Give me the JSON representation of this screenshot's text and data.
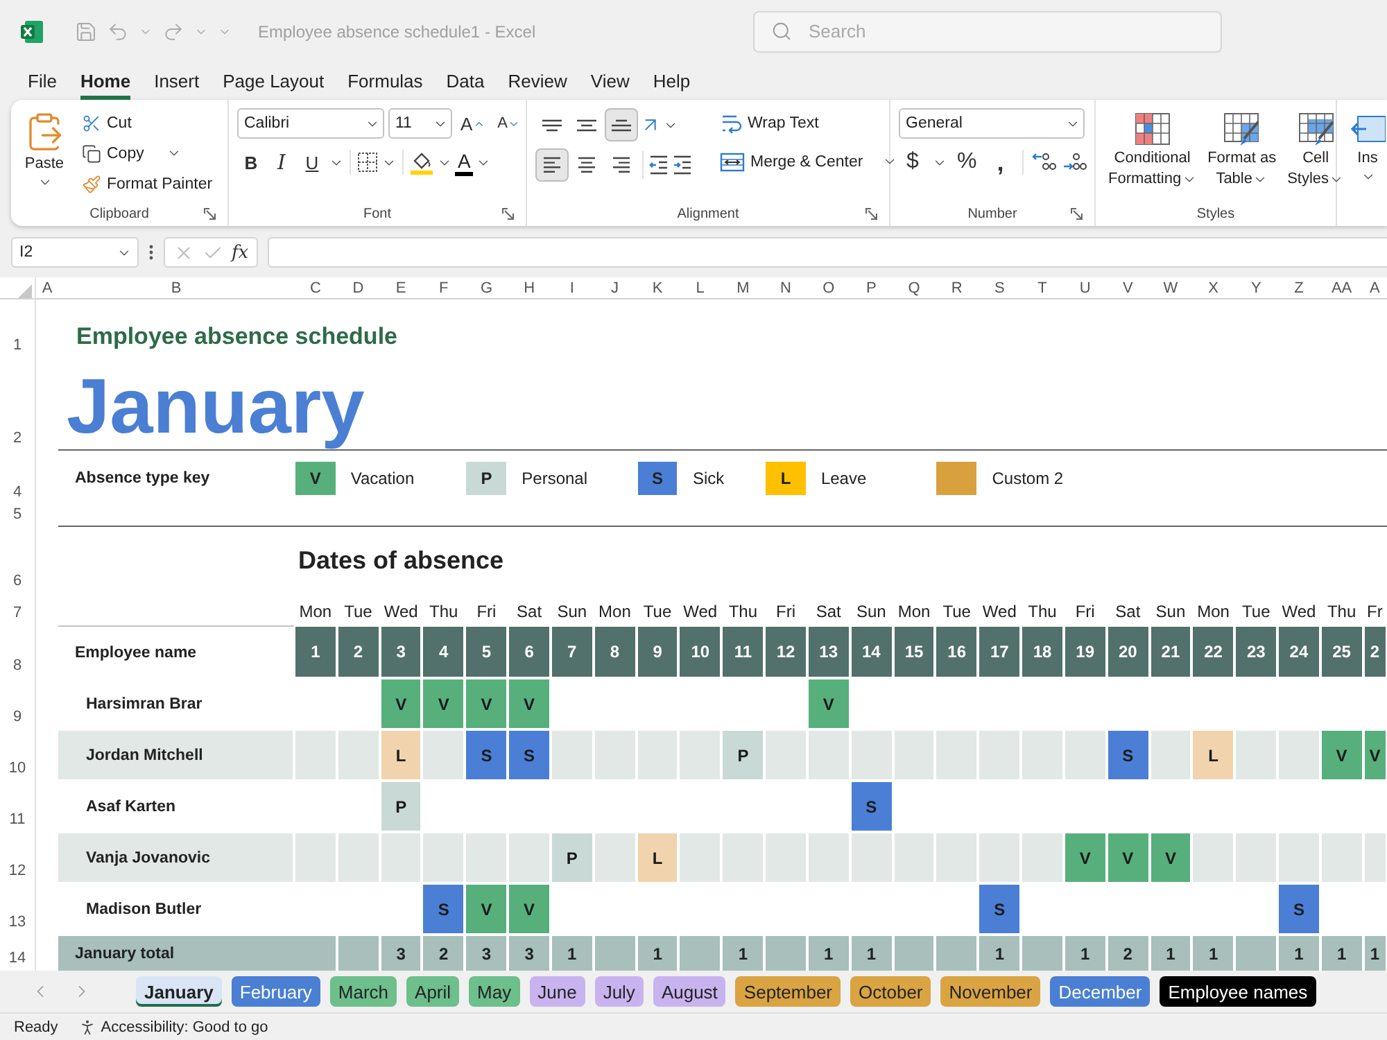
{
  "titlebar": {
    "title": "Employee absence schedule1 - Excel",
    "search": {
      "placeholder": "Search"
    }
  },
  "menu": [
    {
      "label": "File",
      "selected": false
    },
    {
      "label": "Home",
      "selected": true
    },
    {
      "label": "Insert",
      "selected": false
    },
    {
      "label": "Page Layout",
      "selected": false
    },
    {
      "label": "Formulas",
      "selected": false
    },
    {
      "label": "Data",
      "selected": false
    },
    {
      "label": "Review",
      "selected": false
    },
    {
      "label": "View",
      "selected": false
    },
    {
      "label": "Help",
      "selected": false
    }
  ],
  "ribbon": {
    "clipboard": {
      "label": "Clipboard",
      "paste": "Paste",
      "cut": "Cut",
      "copy": "Copy",
      "format_painter": "Format Painter"
    },
    "font": {
      "label": "Font",
      "font_name": "Calibri",
      "font_size": "11",
      "grow": "A",
      "shrink": "A",
      "bold": "B",
      "italic": "I",
      "underline": "U",
      "font_color": "A"
    },
    "alignment": {
      "label": "Alignment",
      "vertical": [
        {
          "kind": "top",
          "selected": false
        },
        {
          "kind": "middle",
          "selected": false
        },
        {
          "kind": "bottom",
          "selected": true
        }
      ],
      "horizontal": [
        {
          "kind": "left",
          "selected": true
        },
        {
          "kind": "center",
          "selected": false
        },
        {
          "kind": "right",
          "selected": false
        }
      ],
      "wrap_text": "Wrap Text",
      "merge": "Merge & Center"
    },
    "number": {
      "label": "Number",
      "format": "General",
      "currency": "$",
      "percent": "%",
      "comma": ","
    },
    "styles": {
      "label": "Styles",
      "buttons": [
        {
          "kind": "conditional",
          "lines": [
            "Conditional",
            "Formatting"
          ]
        },
        {
          "kind": "table",
          "lines": [
            "Format as",
            "Table"
          ]
        },
        {
          "kind": "cell",
          "lines": [
            "Cell",
            "Styles"
          ]
        }
      ]
    },
    "insert": {
      "label": "Ins"
    }
  },
  "formula_bar": {
    "name_box": "I2",
    "function_label": "fx"
  },
  "columns": [
    "A",
    "B",
    "C",
    "D",
    "E",
    "F",
    "G",
    "H",
    "I",
    "J",
    "K",
    "L",
    "M",
    "N",
    "O",
    "P",
    "Q",
    "R",
    "S",
    "T",
    "U",
    "V",
    "W",
    "X",
    "Y",
    "Z",
    "AA",
    "A"
  ],
  "row_headers": [
    "1",
    "2",
    "4",
    "5",
    "6",
    "7",
    "8",
    "9",
    "10",
    "11",
    "12",
    "13",
    "14"
  ],
  "sheet": {
    "title": "Employee absence schedule",
    "month": "January",
    "key_label": "Absence type key",
    "key": [
      {
        "kind": "vacation",
        "code": "V",
        "label": "Vacation"
      },
      {
        "kind": "personal",
        "code": "P",
        "label": "Personal"
      },
      {
        "kind": "sick",
        "code": "S",
        "label": "Sick"
      },
      {
        "kind": "leave",
        "code": "L",
        "label": "Leave"
      },
      {
        "kind": "custom",
        "label": "Custom 2"
      }
    ],
    "dates_heading": "Dates of absence",
    "weekdays": [
      "Mon",
      "Tue",
      "Wed",
      "Thu",
      "Fri",
      "Sat",
      "Sun",
      "Mon",
      "Tue",
      "Wed",
      "Thu",
      "Fri",
      "Sat",
      "Sun",
      "Mon",
      "Tue",
      "Wed",
      "Thu",
      "Fri",
      "Sat",
      "Sun",
      "Mon",
      "Tue",
      "Wed",
      "Thu",
      "Fr"
    ],
    "name_header": "Employee name",
    "days": [
      "1",
      "2",
      "3",
      "4",
      "5",
      "6",
      "7",
      "8",
      "9",
      "10",
      "11",
      "12",
      "13",
      "14",
      "15",
      "16",
      "17",
      "18",
      "19",
      "20",
      "21",
      "22",
      "23",
      "24",
      "25",
      "2"
    ],
    "employees": [
      {
        "name": "Harsimran Brar",
        "cells": [
          {},
          {},
          {
            "kind": "vacation",
            "code": "V"
          },
          {
            "kind": "vacation",
            "code": "V"
          },
          {
            "kind": "vacation",
            "code": "V"
          },
          {
            "kind": "vacation",
            "code": "V"
          },
          {},
          {},
          {},
          {},
          {},
          {},
          {
            "kind": "vacation",
            "code": "V"
          },
          {},
          {},
          {},
          {},
          {},
          {},
          {},
          {},
          {},
          {},
          {},
          {},
          {}
        ]
      },
      {
        "name": "Jordan Mitchell",
        "cells": [
          {},
          {},
          {
            "kind": "leave",
            "code": "L"
          },
          {},
          {
            "kind": "sick",
            "code": "S"
          },
          {
            "kind": "sick",
            "code": "S"
          },
          {},
          {},
          {},
          {},
          {
            "kind": "personal",
            "code": "P"
          },
          {},
          {},
          {},
          {},
          {},
          {},
          {},
          {},
          {
            "kind": "sick",
            "code": "S"
          },
          {},
          {
            "kind": "leave",
            "code": "L"
          },
          {},
          {},
          {
            "kind": "vacation",
            "code": "V"
          },
          {
            "kind": "vacation",
            "code": "V"
          }
        ]
      },
      {
        "name": "Asaf Karten",
        "cells": [
          {},
          {},
          {
            "kind": "personal",
            "code": "P"
          },
          {},
          {},
          {},
          {},
          {},
          {},
          {},
          {},
          {},
          {},
          {
            "kind": "sick",
            "code": "S"
          },
          {},
          {},
          {},
          {},
          {},
          {},
          {},
          {},
          {},
          {},
          {},
          {}
        ]
      },
      {
        "name": "Vanja Jovanovic",
        "cells": [
          {},
          {},
          {},
          {},
          {},
          {},
          {
            "kind": "personal",
            "code": "P"
          },
          {},
          {
            "kind": "leave",
            "code": "L"
          },
          {},
          {},
          {},
          {},
          {},
          {},
          {},
          {},
          {},
          {
            "kind": "vacation",
            "code": "V"
          },
          {
            "kind": "vacation",
            "code": "V"
          },
          {
            "kind": "vacation",
            "code": "V"
          },
          {},
          {},
          {},
          {},
          {}
        ]
      },
      {
        "name": "Madison Butler",
        "cells": [
          {},
          {},
          {},
          {
            "kind": "sick",
            "code": "S"
          },
          {
            "kind": "vacation",
            "code": "V"
          },
          {
            "kind": "vacation",
            "code": "V"
          },
          {},
          {},
          {},
          {},
          {},
          {},
          {},
          {},
          {},
          {},
          {
            "kind": "sick",
            "code": "S"
          },
          {},
          {},
          {},
          {},
          {},
          {},
          {
            "kind": "sick",
            "code": "S"
          },
          {},
          {}
        ]
      }
    ],
    "total": {
      "label": "January total",
      "cells": [
        {},
        {
          "value": "3"
        },
        {
          "value": "2"
        },
        {
          "value": "3"
        },
        {
          "value": "3"
        },
        {
          "value": "1"
        },
        {},
        {
          "value": "1"
        },
        {},
        {
          "value": "1"
        },
        {},
        {
          "value": "1"
        },
        {
          "value": "1"
        },
        {},
        {},
        {
          "value": "1"
        },
        {},
        {
          "value": "1"
        },
        {
          "value": "2"
        },
        {
          "value": "1"
        },
        {
          "value": "1"
        },
        {},
        {
          "value": "1"
        },
        {
          "value": "1"
        },
        {
          "value": "1"
        }
      ]
    }
  },
  "sheet_tabs": [
    {
      "label": "January",
      "selected": true
    },
    {
      "label": "February",
      "selected": false,
      "color": "#4a7fd4"
    },
    {
      "label": "March",
      "selected": false,
      "color": "#6dbf8c"
    },
    {
      "label": "April",
      "selected": false,
      "color": "#6dbf8c"
    },
    {
      "label": "May",
      "selected": false,
      "color": "#6dbf8c"
    },
    {
      "label": "June",
      "selected": false,
      "color": "#c9b3ef"
    },
    {
      "label": "July",
      "selected": false,
      "color": "#c9b3ef"
    },
    {
      "label": "August",
      "selected": false,
      "color": "#c9b3ef"
    },
    {
      "label": "September",
      "selected": false,
      "color": "#d9a441"
    },
    {
      "label": "October",
      "selected": false,
      "color": "#d9a441"
    },
    {
      "label": "November",
      "selected": false,
      "color": "#d9a441"
    },
    {
      "label": "December",
      "selected": false,
      "color": "#4a7fd4"
    },
    {
      "label": "Employee names",
      "selected": false,
      "color": "#000000"
    }
  ],
  "status_bar": {
    "state": "Ready",
    "accessibility": "Accessibility: Good to go"
  }
}
